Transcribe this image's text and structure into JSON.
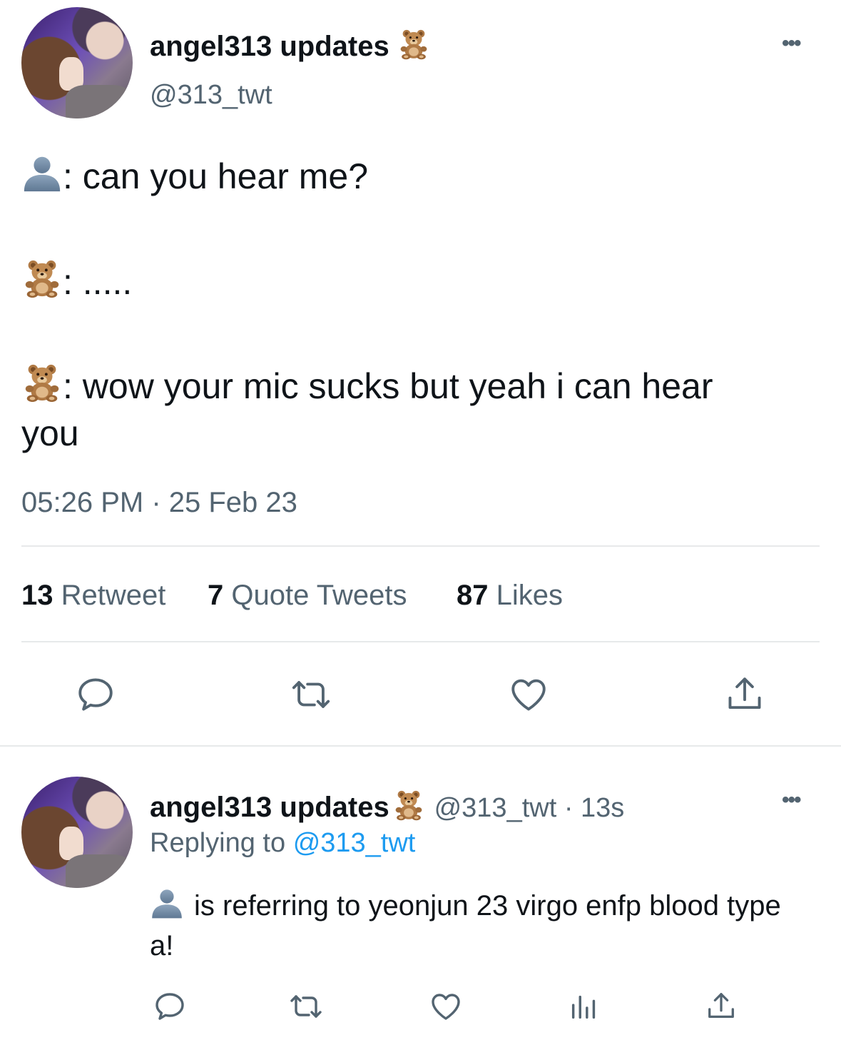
{
  "tweet": {
    "author_name": "angel313 updates",
    "author_handle": "@313_twt",
    "lines": [
      ": can you hear me?",
      ": .....",
      ": wow your mic sucks but yeah i can hear",
      "you"
    ],
    "timestamp": "05:26 PM · 25 Feb 23",
    "stats": {
      "retweet_count": "13",
      "retweet_label": "Retweet",
      "quote_count": "7",
      "quote_label": "Quote Tweets",
      "likes_count": "87",
      "likes_label": "Likes"
    },
    "icons": {
      "name_badge": "teddy-bear-emoji",
      "speaker_1": "bust-silhouette-emoji",
      "speaker_2": "teddy-bear-emoji",
      "speaker_3": "teddy-bear-emoji"
    }
  },
  "reply": {
    "author_name": "angel313 updates",
    "meta": "@313_twt · 13s",
    "replying_prefix": "Replying to",
    "replying_handle": "@313_twt",
    "text": "is referring to yeonjun 23 virgo enfp blood type a!",
    "icons": {
      "name_badge": "teddy-bear-emoji",
      "speaker": "bust-silhouette-emoji"
    }
  },
  "colors": {
    "text": "#0f1419",
    "secondary": "#536471",
    "link": "#1d9bf0",
    "divider": "#e7e9ea"
  }
}
